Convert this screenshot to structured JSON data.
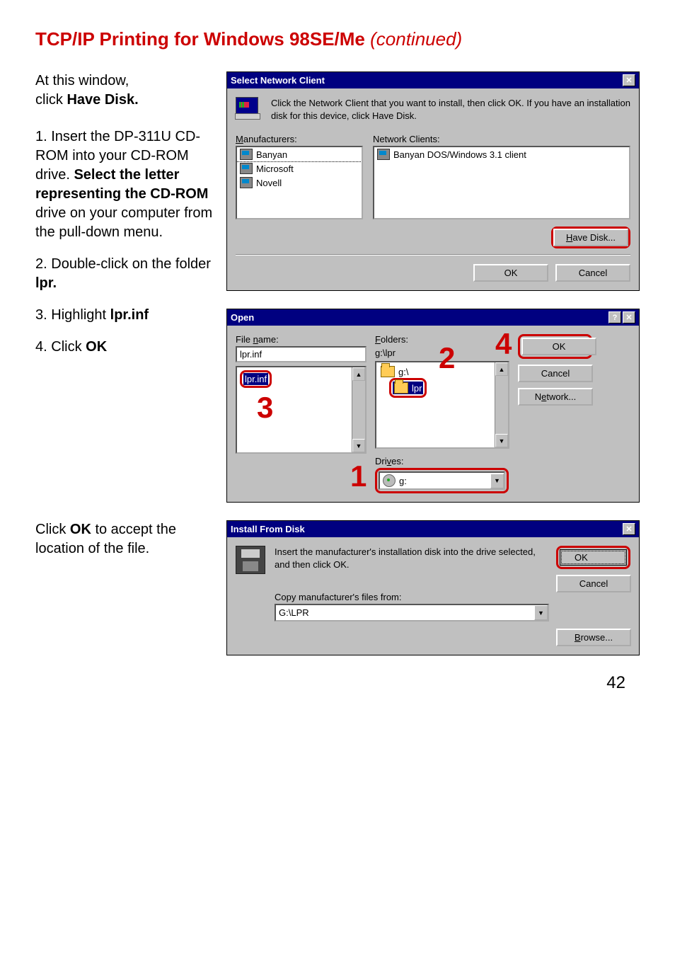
{
  "page": {
    "title_main": "TCP/IP Printing for Windows 98SE/Me",
    "title_cont": " (continued)",
    "page_number": "42"
  },
  "instr1": {
    "line1": "At this window,",
    "line2_pre": "click ",
    "line2_bold": "Have Disk."
  },
  "steps": {
    "s1_a": "Insert the DP-311U CD-ROM into your CD-ROM drive.",
    "s1_b_bold": "Select the letter representing the CD-ROM",
    "s1_c": " drive on your computer from the pull-down menu.",
    "s2_a": "Double-click on the folder ",
    "s2_b_bold": "lpr.",
    "s3_a": "Highlight ",
    "s3_b_bold": "lpr.inf",
    "s4_a": "Click ",
    "s4_b_bold": "OK"
  },
  "instr2": {
    "a": "Click ",
    "b_bold": "OK",
    "c": " to accept the location of the file."
  },
  "dialog1": {
    "title": "Select Network Client",
    "text": "Click the Network Client that you want to install, then click OK. If you have an installation disk for this device, click Have Disk.",
    "mfr_label": "Manufacturers:",
    "nc_label": "Network Clients:",
    "mfr_items": [
      "Banyan",
      "Microsoft",
      "Novell"
    ],
    "nc_items": [
      "Banyan DOS/Windows 3.1 client"
    ],
    "have_disk": "Have Disk...",
    "ok": "OK",
    "cancel": "Cancel"
  },
  "dialog2": {
    "title": "Open",
    "file_name_label": "File name:",
    "file_name_value": "lpr.inf",
    "file_item": "lpr.inf",
    "folders_label": "Folders:",
    "folders_path": "g:\\lpr",
    "folder_g": "g:\\",
    "folder_lpr": "lpr",
    "drives_label": "Drives:",
    "drive_value": " g:",
    "ok": "OK",
    "cancel": "Cancel",
    "network": "Network...",
    "num1": "1",
    "num2": "2",
    "num3": "3",
    "num4": "4"
  },
  "dialog3": {
    "title": "Install From Disk",
    "text": "Insert the manufacturer's installation disk into the drive selected, and then click OK.",
    "copy_label": "Copy manufacturer's files from:",
    "path_value": "G:\\LPR",
    "ok": "OK",
    "cancel": "Cancel",
    "browse": "Browse..."
  }
}
